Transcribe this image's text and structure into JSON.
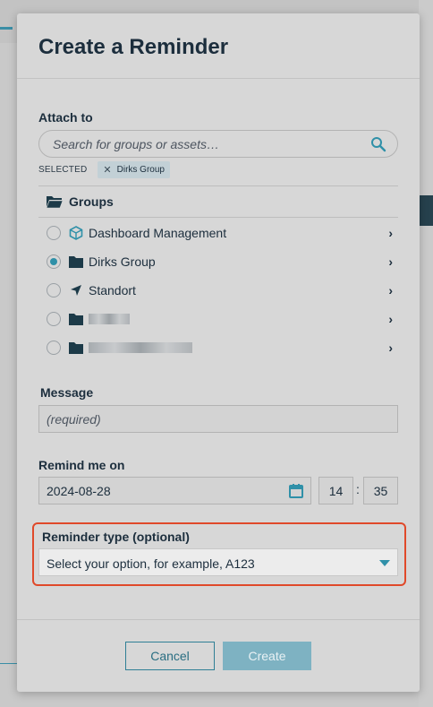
{
  "modal": {
    "title": "Create a Reminder"
  },
  "attach": {
    "label": "Attach to",
    "search_placeholder": "Search for groups or assets…",
    "selected_label": "SELECTED",
    "selected_chips": [
      "Dirks Group"
    ]
  },
  "tree": {
    "header": "Groups",
    "items": [
      {
        "label": "Dashboard Management",
        "icon": "cube-icon",
        "selected": false
      },
      {
        "label": "Dirks Group",
        "icon": "folder-icon",
        "selected": true
      },
      {
        "label": "Standort",
        "icon": "navigation-arrow-icon",
        "selected": false
      },
      {
        "label": "",
        "icon": "folder-icon",
        "selected": false
      },
      {
        "label": "",
        "icon": "folder-icon",
        "selected": false
      }
    ]
  },
  "message": {
    "label": "Message",
    "placeholder": "(required)"
  },
  "remind": {
    "label": "Remind me on",
    "date": "2024-08-28",
    "hour": "14",
    "separator": ":",
    "minute": "35"
  },
  "reminder_type": {
    "label": "Reminder type (optional)",
    "value": "Select your option, for example, A123"
  },
  "buttons": {
    "cancel": "Cancel",
    "create": "Create"
  },
  "colors": {
    "accent": "#2f90a8",
    "highlight": "#e0492a",
    "title": "#1c2e3d"
  }
}
